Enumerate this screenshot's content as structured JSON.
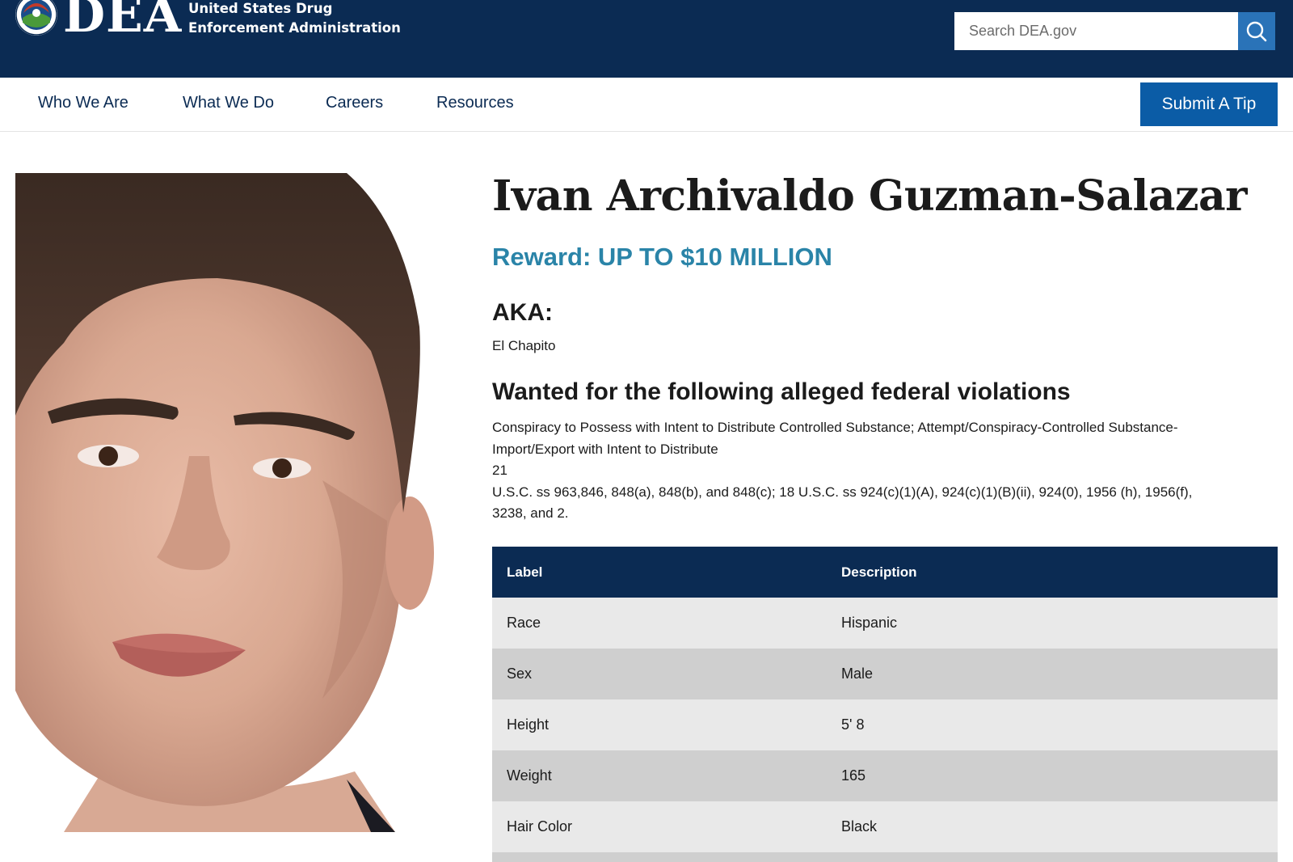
{
  "header": {
    "logo_text": "DEA",
    "agency_name": "United States Drug Enforcement Administration",
    "logo_icon": "dea-seal-icon",
    "search": {
      "placeholder": "Search DEA.gov",
      "icon": "search-icon"
    }
  },
  "nav": {
    "items": [
      {
        "label": "Who We Are"
      },
      {
        "label": "What We Do"
      },
      {
        "label": "Careers"
      },
      {
        "label": "Resources"
      }
    ],
    "cta_label": "Submit A Tip"
  },
  "profile": {
    "name": "Ivan Archivaldo Guzman-Salazar",
    "reward": "Reward: UP TO $10 MILLION",
    "aka_heading": "AKA:",
    "aka_value": "El Chapito",
    "violations_heading": "Wanted for the following alleged federal violations",
    "violations_lines": [
      "Conspiracy to Possess with Intent to Distribute Controlled Substance; Attempt/Conspiracy-Controlled Substance-",
      "Import/Export with Intent to Distribute",
      "21",
      "U.S.C. ss 963,846, 848(a), 848(b), and 848(c); 18 U.S.C. ss 924(c)(1)(A), 924(c)(1)(B)(ii), 924(0), 1956 (h), 1956(f),",
      "3238, and 2."
    ]
  },
  "details_table": {
    "headers": [
      "Label",
      "Description"
    ],
    "rows": [
      [
        "Race",
        "Hispanic"
      ],
      [
        "Sex",
        "Male"
      ],
      [
        "Height",
        "5' 8"
      ],
      [
        "Weight",
        "165"
      ],
      [
        "Hair Color",
        "Black"
      ]
    ]
  },
  "colors": {
    "header_bg": "#0b2b53",
    "nav_text": "#0b2b53",
    "cta_bg": "#0b5ca6",
    "search_button_bg": "#2a73b8",
    "reward_text": "#2a84a8",
    "row_light": "#e9e9e9",
    "row_dark": "#cfcfcf"
  }
}
